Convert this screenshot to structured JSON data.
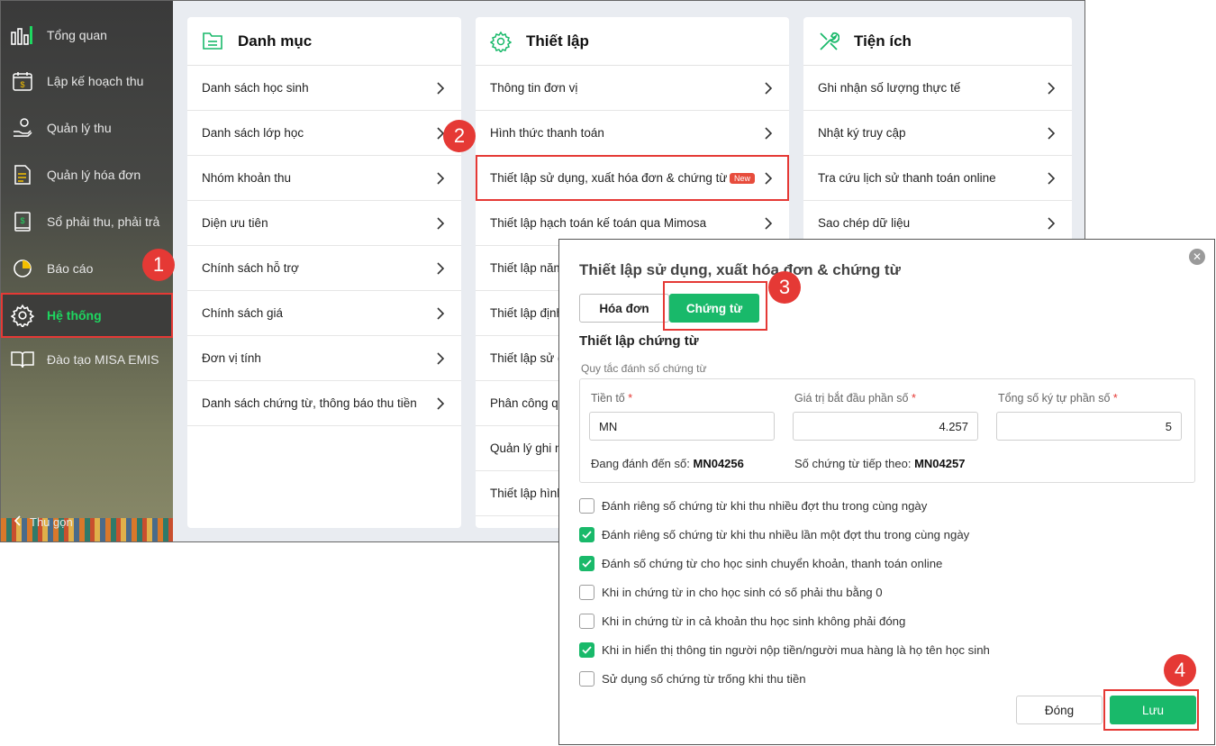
{
  "sidebar": {
    "items": [
      {
        "label": "Tổng quan",
        "icon": "bar-chart-icon"
      },
      {
        "label": "Lập kế hoạch thu",
        "icon": "calendar-dollar-icon"
      },
      {
        "label": "Quản lý thu",
        "icon": "hand-coin-icon"
      },
      {
        "label": "Quản lý hóa đơn",
        "icon": "invoice-icon"
      },
      {
        "label": "Sổ phải thu, phải trả",
        "icon": "ledger-icon"
      },
      {
        "label": "Báo cáo",
        "icon": "pie-chart-icon"
      },
      {
        "label": "Hệ thống",
        "icon": "gear-icon"
      },
      {
        "label": "Đào tạo MISA EMIS",
        "icon": "book-icon"
      }
    ],
    "collapse_label": "Thu gọn"
  },
  "cards": {
    "catalog": {
      "title": "Danh mục",
      "items": [
        "Danh sách học sinh",
        "Danh sách lớp học",
        "Nhóm khoản thu",
        "Diện ưu tiên",
        "Chính sách hỗ trợ",
        "Chính sách giá",
        "Đơn vị tính",
        "Danh sách chứng từ, thông báo thu tiền"
      ]
    },
    "settings": {
      "title": "Thiết lập",
      "items": [
        "Thông tin đơn vị",
        "Hình thức thanh toán",
        "Thiết lập sử dụng, xuất hóa đơn & chứng từ",
        "Thiết lập hạch toán kế toán qua Mimosa",
        "Thiết lập năm",
        "Thiết lập định",
        "Thiết lập sử d",
        "Phân công q",
        "Quản lý ghi n",
        "Thiết lập hình"
      ],
      "new_badge": "New"
    },
    "utilities": {
      "title": "Tiện ích",
      "items": [
        "Ghi nhận số lượng thực tế",
        "Nhật ký truy cập",
        "Tra cứu lịch sử thanh toán online",
        "Sao chép dữ liệu"
      ]
    }
  },
  "steps": [
    "1",
    "2",
    "3",
    "4"
  ],
  "dialog": {
    "title": "Thiết lập sử dụng, xuất hóa đơn & chứng từ",
    "tabs": [
      "Hóa đơn",
      "Chứng từ"
    ],
    "active_tab": "Chứng từ",
    "section_title": "Thiết lập chứng từ",
    "rule_label": "Quy tắc đánh số chứng từ",
    "fields": {
      "prefix": {
        "label": "Tiền tố",
        "value": "MN"
      },
      "start_value": {
        "label": "Giá trị bắt đầu phần số",
        "value": "4.257"
      },
      "total_digits": {
        "label": "Tổng số ký tự phần số",
        "value": "5"
      }
    },
    "current_label": "Đang đánh đến số:",
    "current_value": "MN04256",
    "next_label": "Số chứng từ tiếp theo:",
    "next_value": "MN04257",
    "options": [
      {
        "label": "Đánh riêng số chứng từ khi thu nhiều đợt thu trong cùng ngày",
        "checked": false
      },
      {
        "label": "Đánh riêng số chứng từ khi thu nhiều lần một đợt thu trong cùng ngày",
        "checked": true
      },
      {
        "label": "Đánh số chứng từ cho học sinh chuyển khoản, thanh toán online",
        "checked": true
      },
      {
        "label": "Khi in chứng từ in cho học sinh có số phải thu bằng 0",
        "checked": false
      },
      {
        "label": "Khi in chứng từ in cả khoản thu học sinh không phải đóng",
        "checked": false
      },
      {
        "label": "Khi in hiển thị thông tin người nộp tiền/người mua hàng là họ tên học sinh",
        "checked": true
      },
      {
        "label": "Sử dụng số chứng từ trống khi thu tiền",
        "checked": false
      }
    ],
    "close_label": "Đóng",
    "save_label": "Lưu"
  },
  "colors": {
    "accent": "#19b96a",
    "highlight": "#e53935",
    "sidebar_active_text": "#1ed760"
  }
}
